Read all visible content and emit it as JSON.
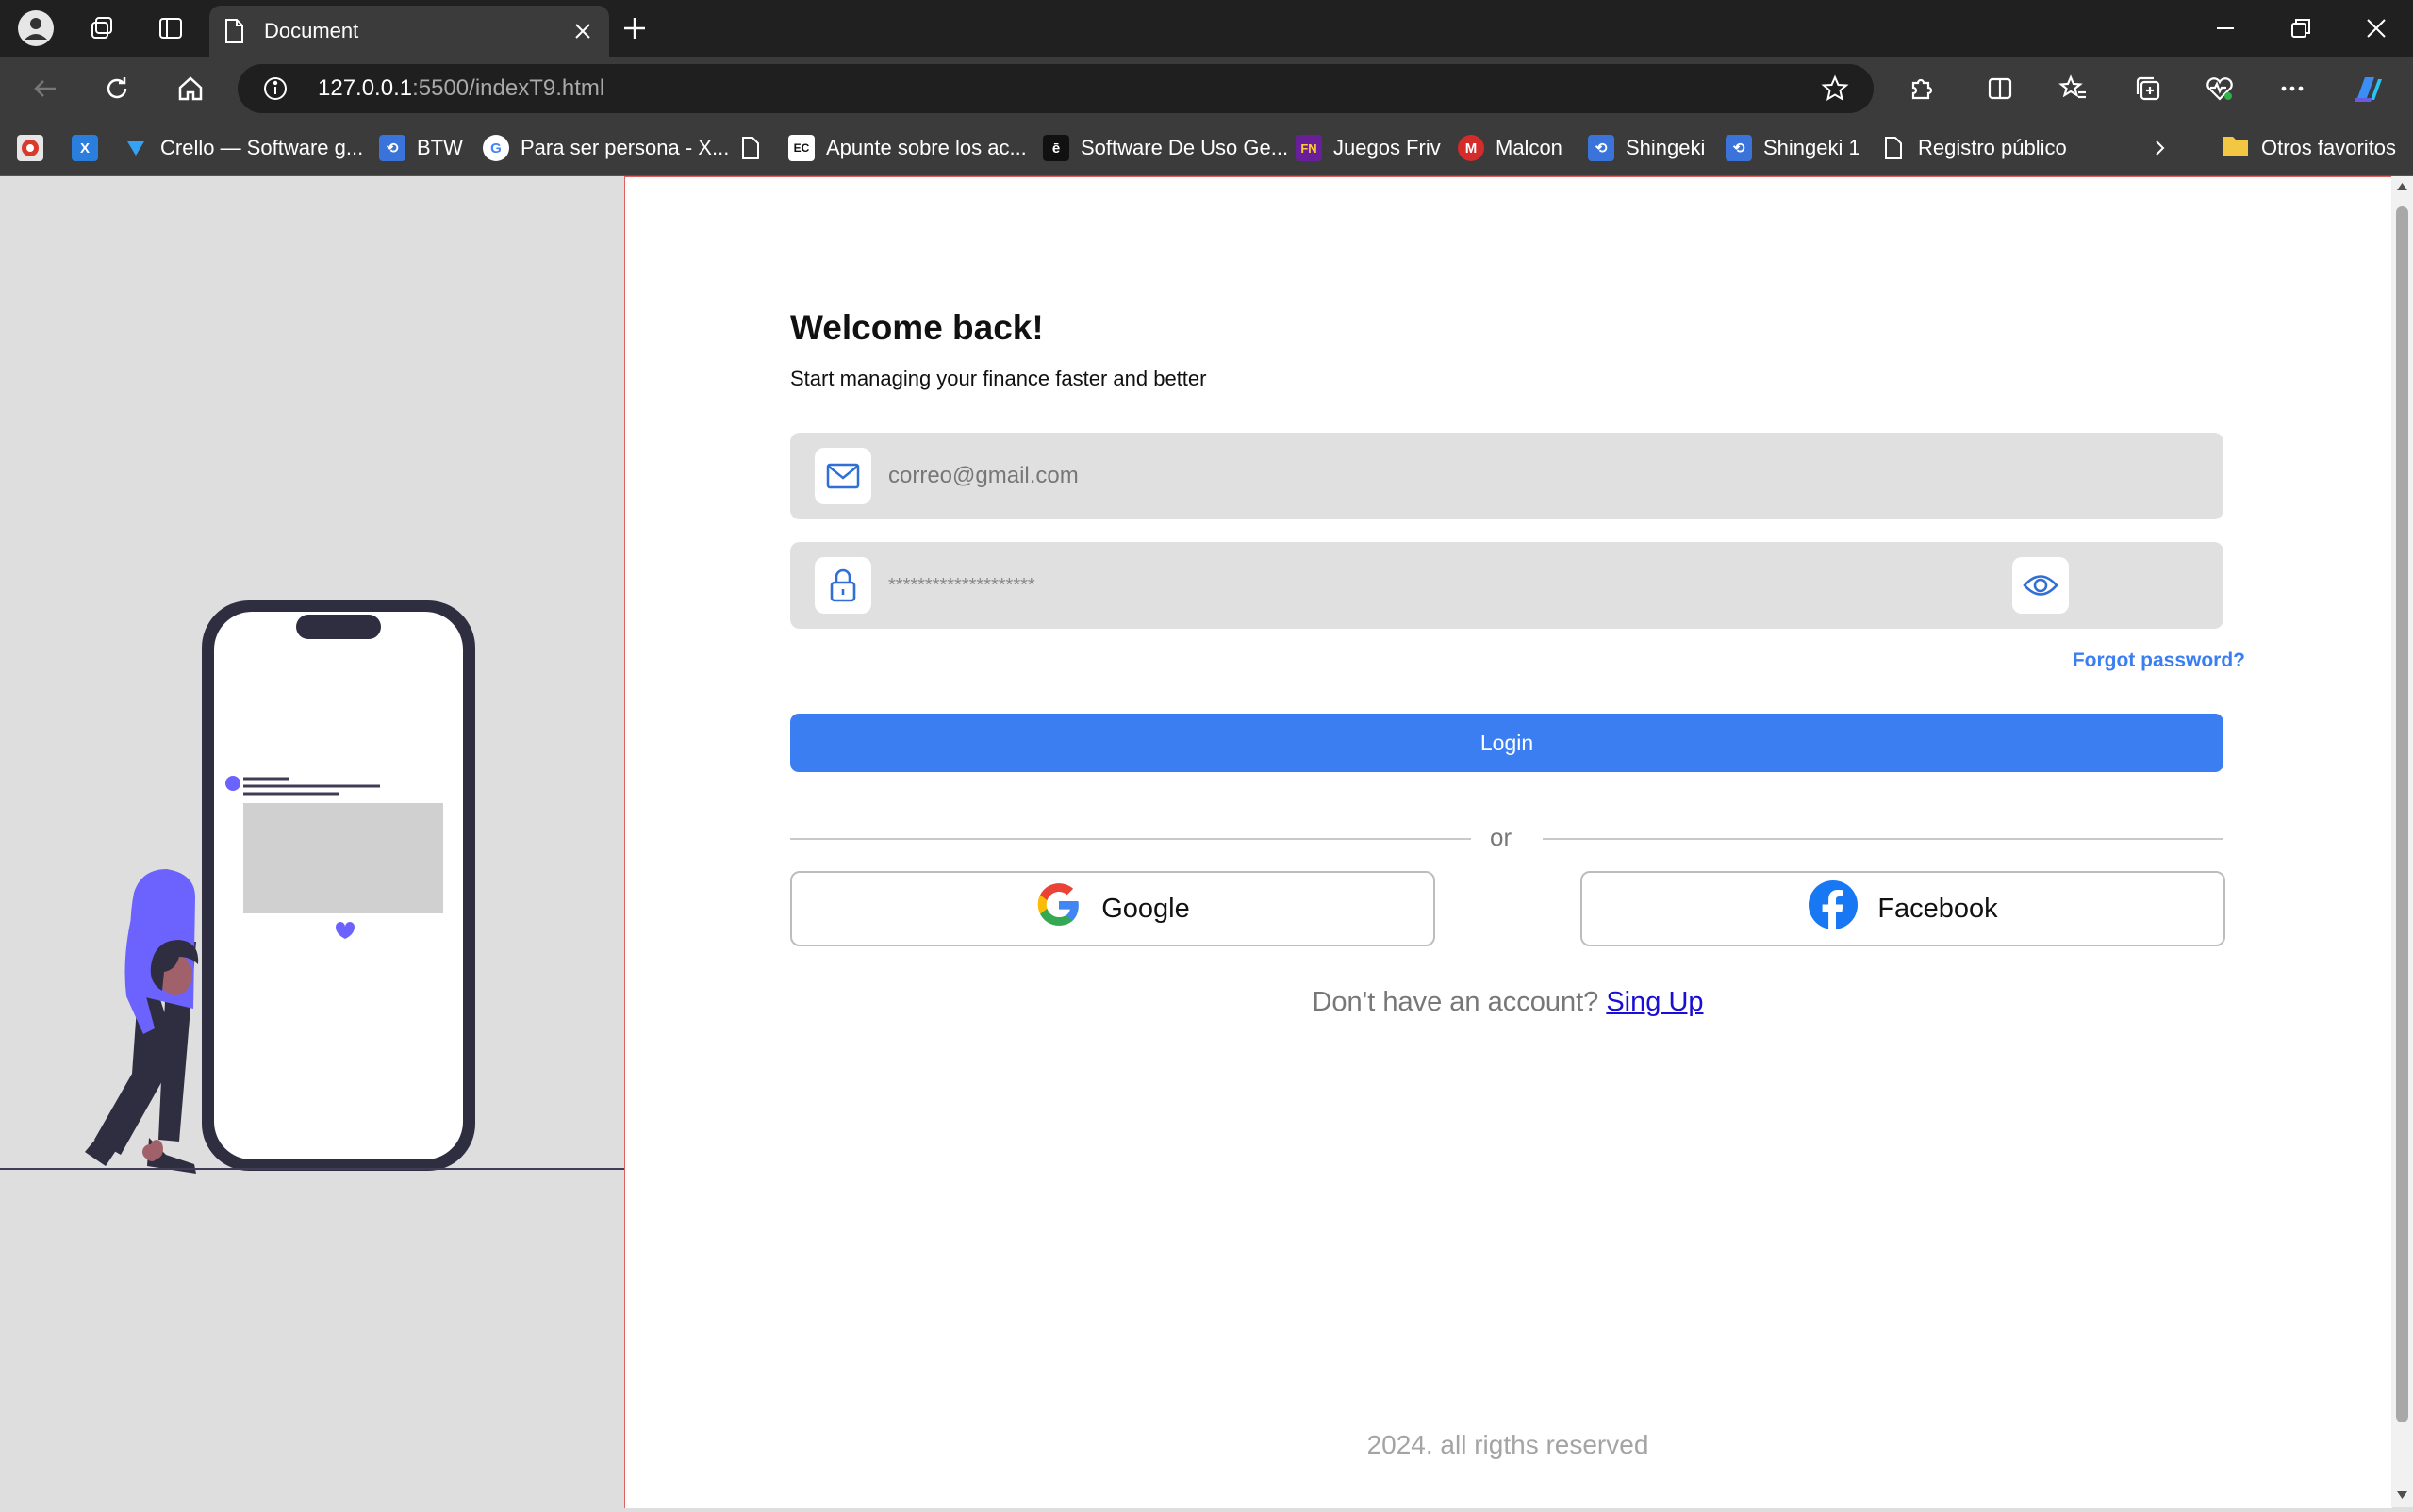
{
  "browser": {
    "tab_title": "Document",
    "url_host": "127.0.0.1",
    "url_rest": ":5500/indexT9.html",
    "bookmarks": [
      {
        "label": ""
      },
      {
        "label": ""
      },
      {
        "label": "Crello — Software g..."
      },
      {
        "label": "BTW"
      },
      {
        "label": "Para ser persona - X..."
      },
      {
        "label": ""
      },
      {
        "label": "Apunte sobre los ac..."
      },
      {
        "label": "Software De Uso Ge..."
      },
      {
        "label": "Juegos Friv"
      },
      {
        "label": "Malcon"
      },
      {
        "label": "Shingeki"
      },
      {
        "label": "Shingeki 1"
      },
      {
        "label": "Registro público"
      }
    ],
    "other_favorites": "Otros favoritos"
  },
  "login": {
    "title": "Welcome back!",
    "subtitle": "Start managing your finance faster and better",
    "email_placeholder": "correo@gmail.com",
    "password_value": "********************",
    "forgot_label": "Forgot password?",
    "login_label": "Login",
    "or_label": "or",
    "google_label": "Google",
    "facebook_label": "Facebook",
    "signup_prompt": "Don't have an account?",
    "signup_link": "Sing Up",
    "footer": "2024. all rigths reserved"
  },
  "colors": {
    "accent": "#3b7ef2",
    "figure_shirt": "#6c63ff",
    "phone_frame": "#2f2e41"
  }
}
